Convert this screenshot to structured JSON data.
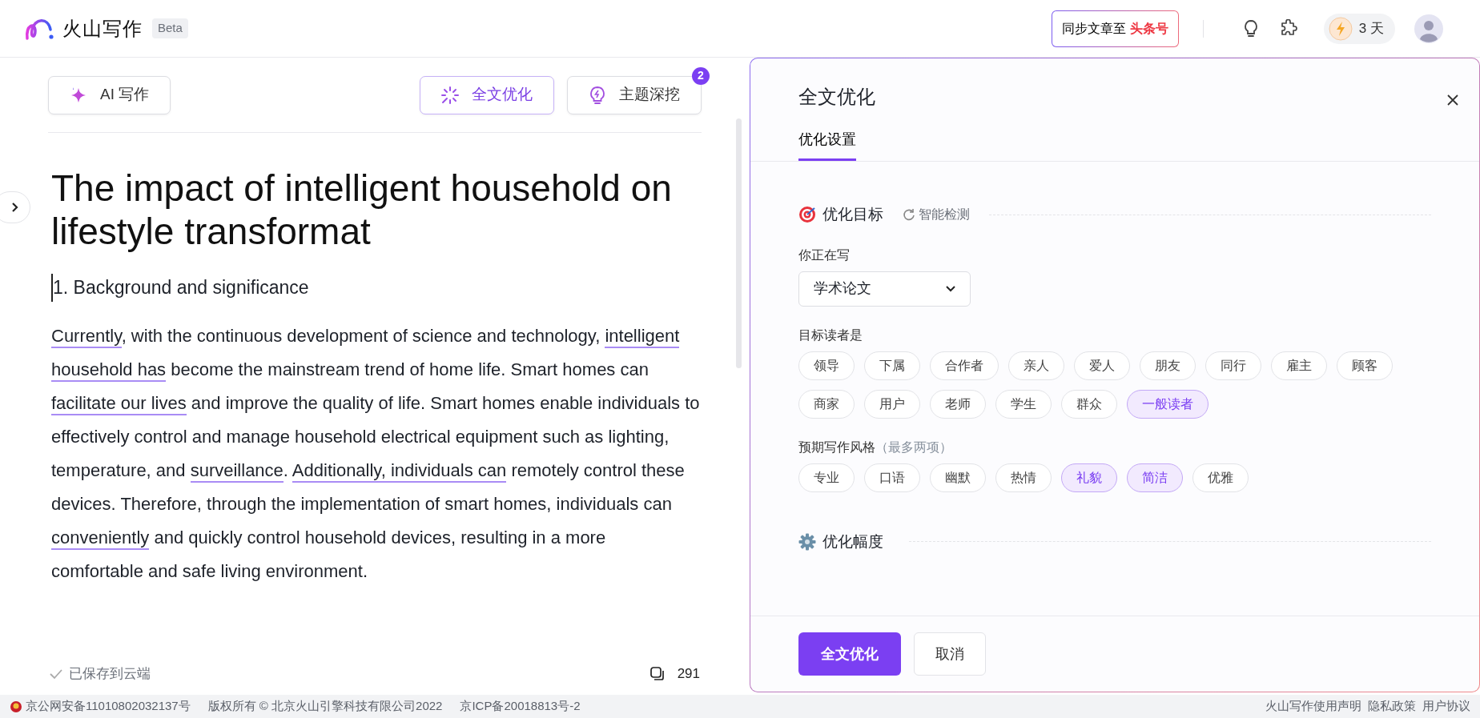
{
  "header": {
    "logo_text": "火山写作",
    "badge": "Beta",
    "sync_button": {
      "label": "同步文章至",
      "target": "头条号"
    },
    "streak": {
      "count": "3",
      "unit": "天"
    }
  },
  "toolbar": {
    "buttons": [
      {
        "label": "AI 写作",
        "kind": "sparkle",
        "selected": false
      },
      {
        "label": "全文优化",
        "kind": "burst",
        "selected": true
      },
      {
        "label": "主题深挖",
        "kind": "bulb",
        "selected": false,
        "badge": "2"
      }
    ]
  },
  "editor": {
    "title": "The impact of intelligent household on lifestyle transformat",
    "heading": "1. Background and significance",
    "paragraph": [
      {
        "text": "Currently",
        "flagged": true
      },
      {
        "text": ", with the continuous development of science and technology, ",
        "flagged": false
      },
      {
        "text": "intelligent household has",
        "flagged": true
      },
      {
        "text": " become the mainstream trend of home life. Smart homes can ",
        "flagged": false
      },
      {
        "text": "facilitate our lives",
        "flagged": true
      },
      {
        "text": " and improve the quality of life. Smart homes enable individuals to effectively control and manage household electrical equipment such as lighting, temperature, and ",
        "flagged": false
      },
      {
        "text": "surveillance",
        "flagged": true
      },
      {
        "text": ". ",
        "flagged": false
      },
      {
        "text": "Additionally, individuals can",
        "flagged": true
      },
      {
        "text": " remotely control these devices. Therefore, through the implementation of smart homes, individuals can ",
        "flagged": false
      },
      {
        "text": "conveniently",
        "flagged": true
      },
      {
        "text": " and quickly control household devices, resulting in a more comfortable and safe living environment.",
        "flagged": false
      }
    ]
  },
  "status": {
    "saved": "已保存到云端",
    "word_count": "291"
  },
  "panel": {
    "title": "全文优化",
    "tabs": [
      {
        "label": "优化设置",
        "selected": true
      }
    ],
    "goal_section": {
      "title": "优化目标",
      "detect_label": "智能检测"
    },
    "writing_type": {
      "label": "你正在写",
      "value": "学术论文"
    },
    "readers": {
      "label": "目标读者是",
      "options": [
        {
          "label": "领导",
          "selected": false
        },
        {
          "label": "下属",
          "selected": false
        },
        {
          "label": "合作者",
          "selected": false
        },
        {
          "label": "亲人",
          "selected": false
        },
        {
          "label": "爱人",
          "selected": false
        },
        {
          "label": "朋友",
          "selected": false
        },
        {
          "label": "同行",
          "selected": false
        },
        {
          "label": "雇主",
          "selected": false
        },
        {
          "label": "顾客",
          "selected": false
        },
        {
          "label": "商家",
          "selected": false
        },
        {
          "label": "用户",
          "selected": false
        },
        {
          "label": "老师",
          "selected": false
        },
        {
          "label": "学生",
          "selected": false
        },
        {
          "label": "群众",
          "selected": false
        },
        {
          "label": "一般读者",
          "selected": true
        }
      ]
    },
    "style": {
      "label": "预期写作风格",
      "hint": "（最多两项）",
      "options": [
        {
          "label": "专业",
          "selected": false
        },
        {
          "label": "口语",
          "selected": false
        },
        {
          "label": "幽默",
          "selected": false
        },
        {
          "label": "热情",
          "selected": false
        },
        {
          "label": "礼貌",
          "selected": true
        },
        {
          "label": "简洁",
          "selected": true
        },
        {
          "label": "优雅",
          "selected": false
        }
      ]
    },
    "range_section": {
      "title": "优化幅度"
    },
    "buttons": {
      "primary": "全文优化",
      "cancel": "取消"
    }
  },
  "footer": {
    "left": [
      "京公网安备11010802032137号",
      "版权所有 © 北京火山引擎科技有限公司2022",
      "京ICP备20018813号-2"
    ],
    "right": [
      "火山写作使用声明",
      "隐私政策",
      "用户协议"
    ]
  }
}
